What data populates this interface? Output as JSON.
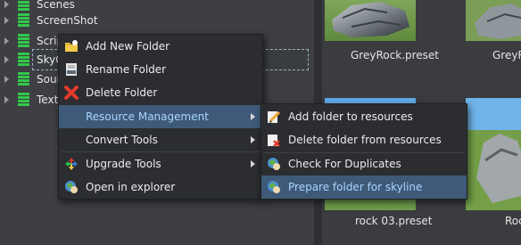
{
  "tree": {
    "items": [
      {
        "label": "Scenes"
      },
      {
        "label": "ScreenShot"
      },
      {
        "label": "Scrip"
      },
      {
        "label": "SkyG"
      },
      {
        "label": "Sour"
      },
      {
        "label": "Textu"
      }
    ]
  },
  "content": {
    "thumbnails": [
      {
        "caption": "GreyRock.preset"
      },
      {
        "caption": "GreyR"
      },
      {
        "caption": "rock 03.preset"
      },
      {
        "caption": "Roc"
      }
    ]
  },
  "context_menu": {
    "items": [
      {
        "label": "Add New Folder",
        "icon": "folder-add-icon"
      },
      {
        "label": "Rename Folder",
        "icon": "rename-icon"
      },
      {
        "label": "Delete Folder",
        "icon": "delete-x-icon"
      },
      {
        "label": "Resource Management",
        "has_submenu": true
      },
      {
        "label": "Convert Tools",
        "has_submenu": true
      },
      {
        "label": "Upgrade Tools",
        "icon": "upgrade-arrows-icon",
        "has_submenu": true
      },
      {
        "label": "Open in explorer",
        "icon": "explorer-globe-icon"
      }
    ]
  },
  "submenu": {
    "items": [
      {
        "label": "Add folder to resources",
        "icon": "edit-pencil-icon"
      },
      {
        "label": "Delete folder from resources",
        "icon": "delete-resource-icon"
      },
      {
        "label": "Check For Duplicates",
        "icon": "duplicates-globe-icon"
      },
      {
        "label": "Prepare folder for skyline",
        "icon": "prepare-globe-icon"
      }
    ]
  },
  "colors": {
    "highlight": "#3e5a78",
    "highlight_text": "#a9d4ff",
    "folder_green": "#33c74a"
  }
}
